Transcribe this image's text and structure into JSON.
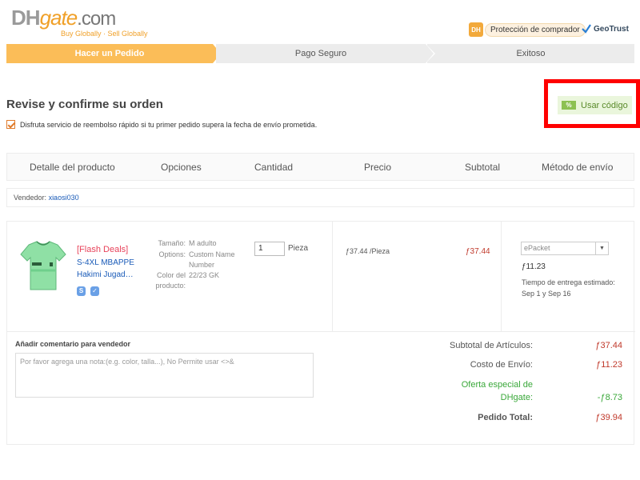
{
  "header": {
    "logo_dh": "DH",
    "logo_gate": "gate",
    "logo_com": ".com",
    "logo_tagline": "Buy Globally · Sell Globally",
    "buyer_badge": "DH",
    "buyer_protection": "Protección de comprador",
    "geotrust": "GeoTrust"
  },
  "steps": [
    "Hacer un Pedido",
    "Pago Seguro",
    "Exitoso"
  ],
  "order": {
    "title": "Revise y confirme su orden",
    "refund_option": "Disfruta servicio de reembolso rápido si tu primer pedido supera la fecha de envío prometida.",
    "refund_checked": true,
    "coupon_icon": "%",
    "coupon_label": "Usar código"
  },
  "table": {
    "headers": [
      "Detalle del producto",
      "Opciones",
      "Cantidad",
      "Precio",
      "Subtotal",
      "Método de envío"
    ]
  },
  "vendor": {
    "label": "Vendedor:",
    "name": "xiaosi030"
  },
  "product": {
    "title_line1": "[Flash Deals]",
    "title_line2": "S-4XL MBAPPE",
    "title_line3": "Hakimi Jugad…",
    "badges": [
      "S",
      "✓"
    ],
    "options": {
      "size_label": "Tamaño:",
      "size_value": "M adulto",
      "options_label": "Options:",
      "options_value_1": "Custom Name",
      "options_value_2": "Number",
      "color_label_1": "Color del",
      "color_label_2": "producto:",
      "color_value": "22/23 GK"
    },
    "quantity": "1",
    "quantity_unit": "Pieza",
    "price": "ƒ37.44 /Pieza",
    "subtotal": "ƒ37.44",
    "shipping_method": "ePacket",
    "shipping_cost": "ƒ11.23",
    "delivery_time": "Tiempo de entrega estimado: Sep 1 y Sep 16"
  },
  "comment": {
    "label": "Añadir comentario para vendedor",
    "placeholder": "Por favor agrega una nota:(e.g. color, talla...), No Permite usar <>&"
  },
  "summary": {
    "items_label": "Subtotal de Artículos:",
    "items_value": "ƒ37.44",
    "shipping_label": "Costo de Envío:",
    "shipping_value": "ƒ11.23",
    "offer_label_1": "Oferta especial de",
    "offer_label_2": "DHgate:",
    "offer_value": "-ƒ8.73",
    "total_label": "Pedido Total:",
    "total_value": "ƒ39.94"
  },
  "colors": {
    "accent": "#fbbd58",
    "price_red": "#c0392b",
    "link_blue": "#1a5bb8",
    "highlight_red": "#ff0000",
    "offer_green": "#3aa83a"
  }
}
